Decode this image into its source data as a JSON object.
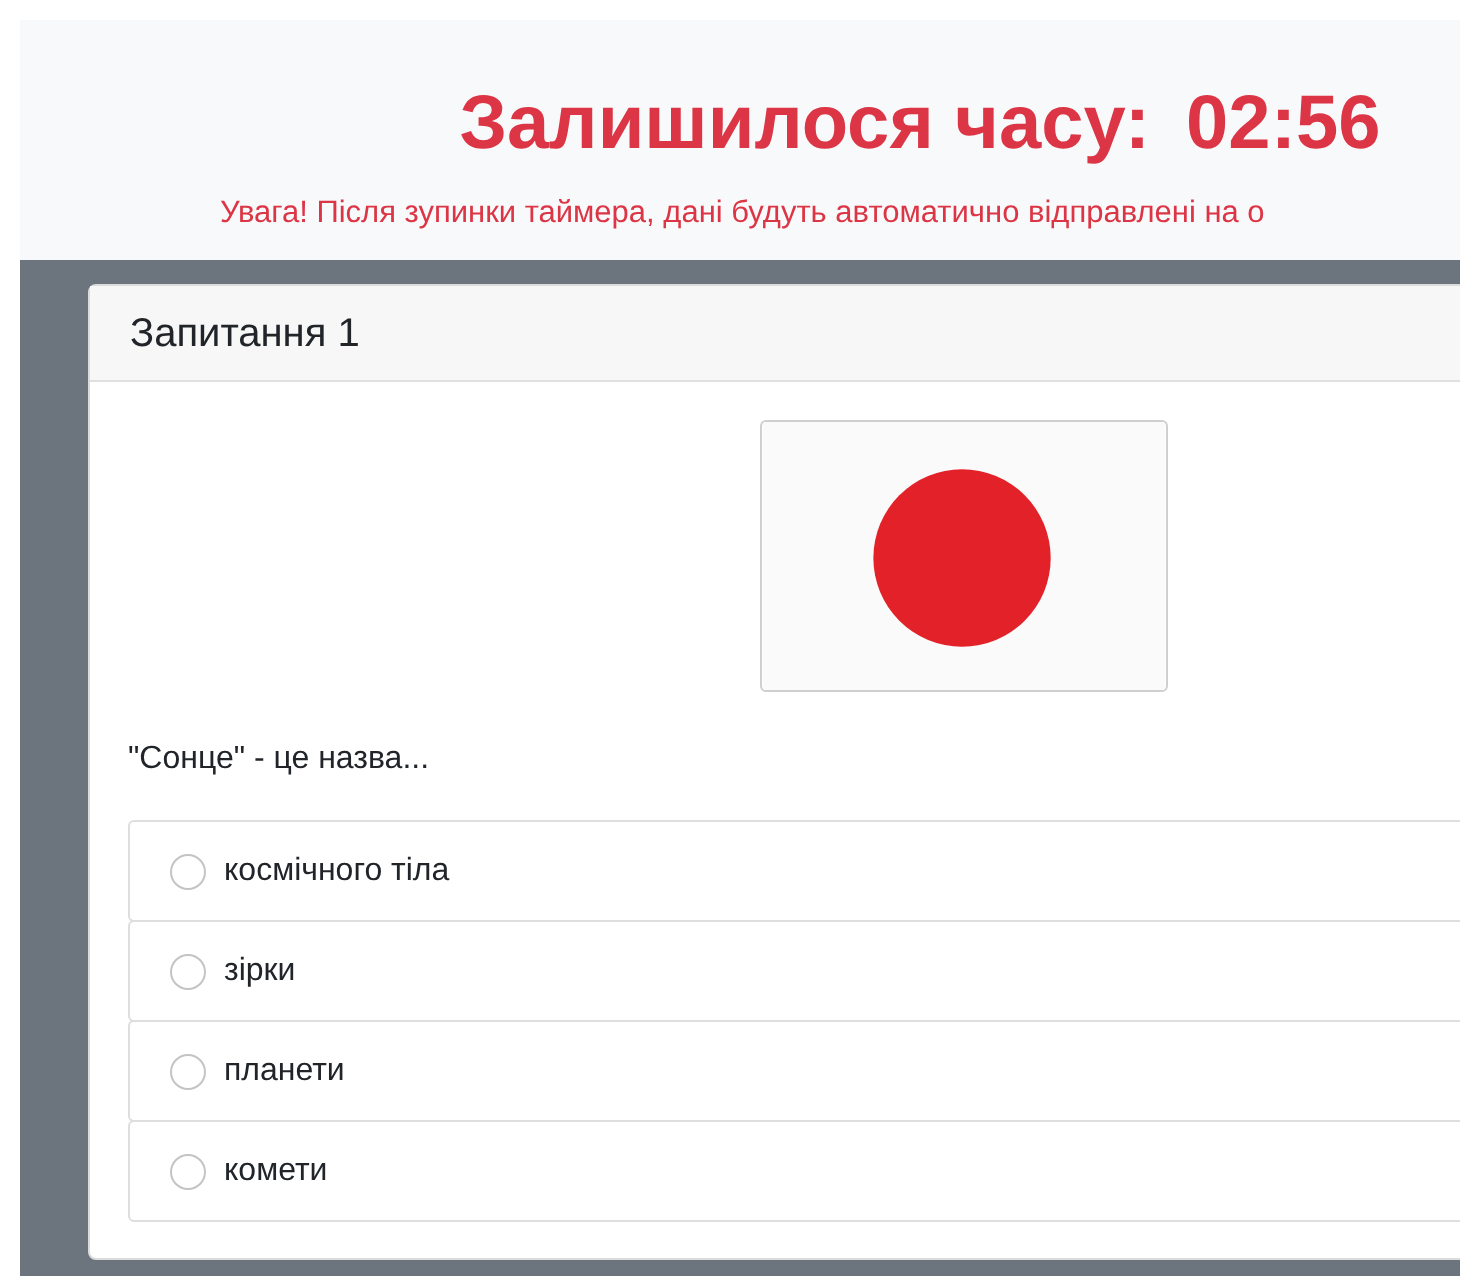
{
  "timer": {
    "label": "Залишилося часу:",
    "time": "02:56",
    "warning": "Увага! Після зупинки таймера, дані будуть автоматично відправлені на о"
  },
  "question": {
    "title": "Запитання 1",
    "kind": "picture",
    "text": "\"Сонце\" - це назва...",
    "options": [
      {
        "label": "космічного тіла",
        "checked": false
      },
      {
        "label": "зірки",
        "checked": false
      },
      {
        "label": "планети",
        "checked": false
      },
      {
        "label": "комети",
        "checked": false
      }
    ]
  }
}
